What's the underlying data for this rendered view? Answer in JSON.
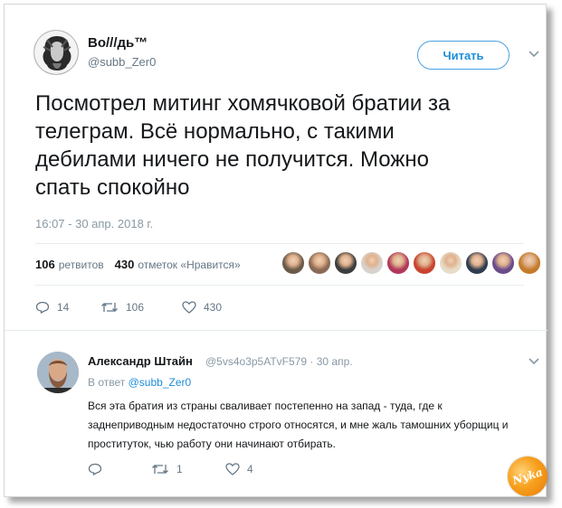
{
  "tweet": {
    "author_name": "Во///дь™",
    "author_handle": "@subb_Zer0",
    "follow_label": "Читать",
    "text": "Посмотрел митинг хомячковой братии за\nтелеграм. Всё нормально, с такими\nдебилами ничего не получится. Можно\nспать спокойно",
    "timestamp": "16:07 - 30 апр. 2018 г.",
    "stats": {
      "retweets_count": "106",
      "retweets_label": "ретвитов",
      "likes_count": "430",
      "likes_label": "отметок «Нравится»"
    },
    "liker_avatar_colors": [
      "#6b5a4a",
      "#8a6a55",
      "#3d3d3d",
      "#d8d2cc",
      "#b0385a",
      "#c8442e",
      "#e7dcc7",
      "#2f3d4f",
      "#6b4c8a",
      "#c47b2a"
    ],
    "actions": {
      "reply_count": "14",
      "retweet_count": "106",
      "like_count": "430"
    }
  },
  "reply": {
    "author_name": "Александр Штайн",
    "author_handle": "@5vs4o3p5ATvF579",
    "separator": "·",
    "date": "30 апр.",
    "reply_to_prefix": "В ответ",
    "reply_to_handle": "@subb_Zer0",
    "text": "Вся эта братия из страны сваливает постепенно на запад - туда, где к заднеприводным недостаточно строго относятся, и мне жаль тамошних уборщиц и проституток, чью работу они начинают  отбирать.",
    "actions": {
      "reply_count": "",
      "retweet_count": "1",
      "like_count": "4"
    }
  },
  "watermark": {
    "text": "Nyka"
  },
  "colors": {
    "accent": "#1d8dd8",
    "muted": "#657786",
    "divider": "#e6ecf0"
  }
}
